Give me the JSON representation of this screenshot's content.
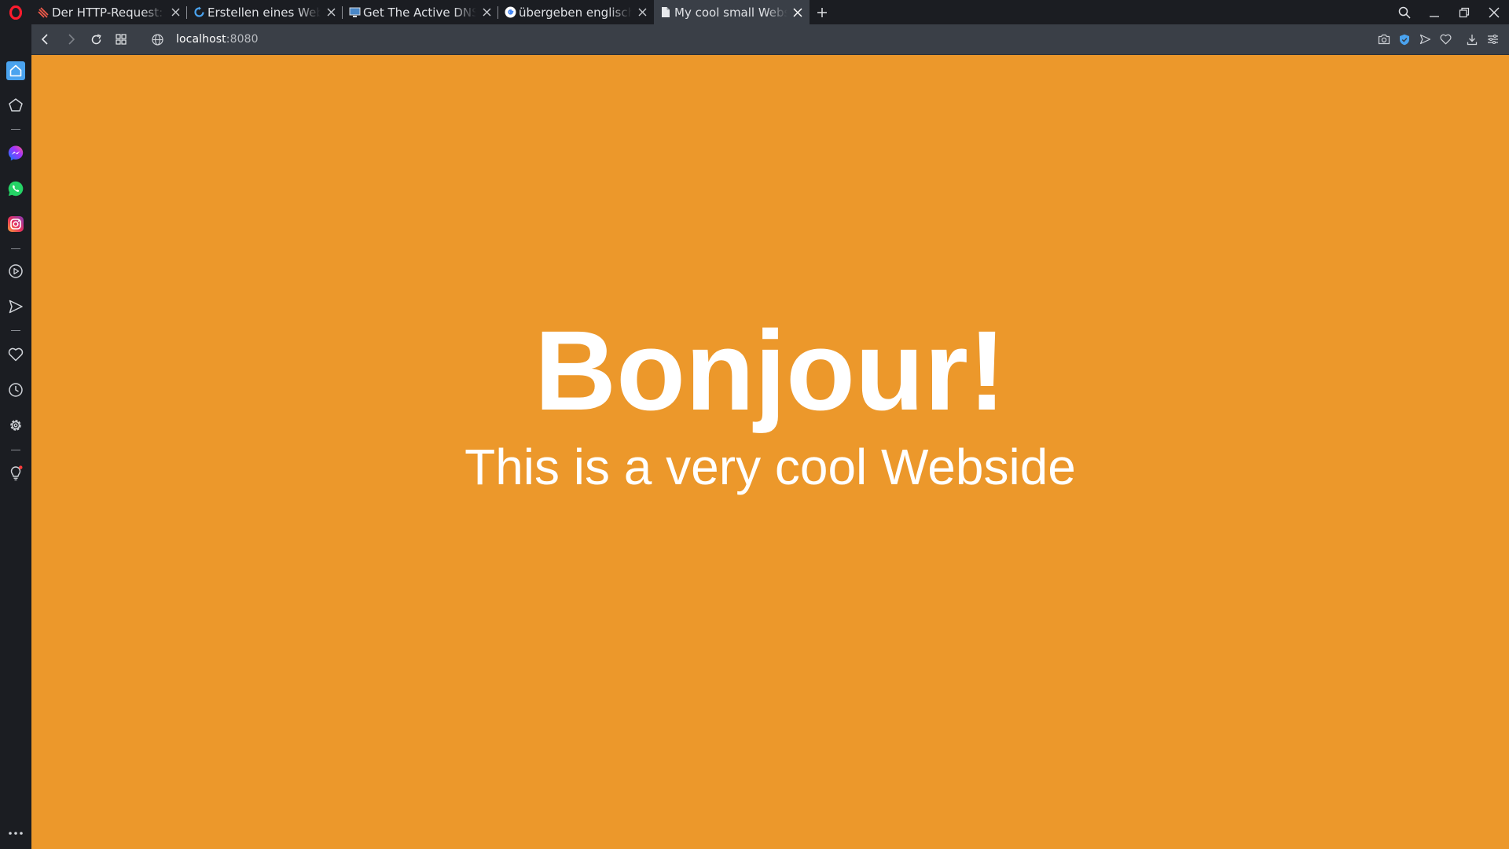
{
  "colors": {
    "chrome_dark": "#1b1d22",
    "toolbar": "#3a3f47",
    "page_background": "#ec982b",
    "opera_red": "#ff1b2d",
    "accent_blue": "#4aa3ef"
  },
  "tabs": [
    {
      "title": "Der HTTP-Request: D",
      "icon": "stack-overflow-favicon-icon",
      "active": false
    },
    {
      "title": "Erstellen eines Webs",
      "icon": "sync-site-favicon-icon",
      "active": false
    },
    {
      "title": "Get The Active DNS S",
      "icon": "monitor-favicon-icon",
      "active": false
    },
    {
      "title": "übergeben englisch",
      "icon": "google-favicon-icon",
      "active": false
    },
    {
      "title": "My cool small Websi",
      "icon": "document-favicon-icon",
      "active": true
    }
  ],
  "address": {
    "host": "localhost",
    "port": ":8080"
  },
  "sidebar": {
    "items": [
      {
        "name": "home-icon"
      },
      {
        "name": "speed-dial-icon"
      },
      {
        "name": "messenger-icon"
      },
      {
        "name": "whatsapp-icon"
      },
      {
        "name": "instagram-icon"
      },
      {
        "name": "player-icon"
      },
      {
        "name": "flow-icon"
      },
      {
        "name": "bookmarks-heart-icon"
      },
      {
        "name": "history-icon"
      },
      {
        "name": "settings-icon"
      },
      {
        "name": "tips-bulb-icon"
      },
      {
        "name": "more-icon"
      }
    ]
  },
  "page": {
    "heading": "Bonjour!",
    "subtitle": "This is a very cool Webside"
  }
}
